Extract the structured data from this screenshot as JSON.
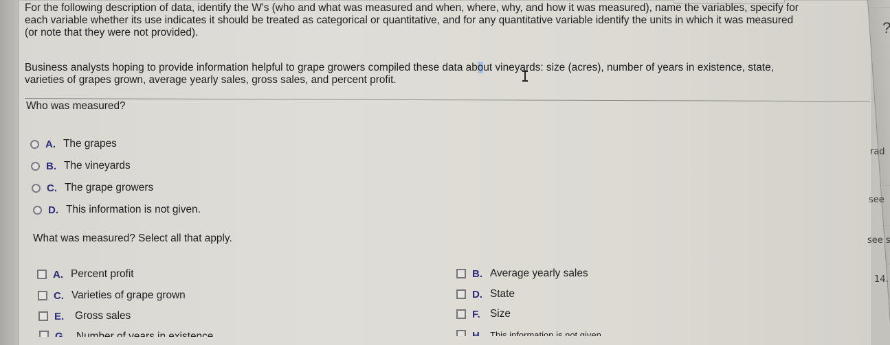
{
  "instructions": "For the following description of data, identify the W's (who and what was measured and when, where, why, and how it was measured), name the variables, specify for each variable whether its use indicates it should be treated as categorical or quantitative, and for any quantitative variable identify the units in which it was measured (or note that they were not provided).",
  "instructions_lines": [
    "For the following description of data, identify the W's (who and what was measured and when, where, why, and how it was measured), name the variables, specify for",
    "each variable whether its use indicates it should be treated as categorical or quantitative, and for any quantitative variable identify the units in which it was measured",
    "(or note that they were not provided)."
  ],
  "description": {
    "line1_before": "Business analysts hoping to provide information helpful to grape growers compiled these data ab",
    "line1_highlight": "o",
    "line1_after": "ut vineyards: size (acres), number of years in existence, state,",
    "line2": "varieties of grapes grown, average yearly sales, gross sales, and percent profit."
  },
  "question_who": {
    "prompt": "Who was measured?",
    "type": "radio",
    "options": [
      {
        "letter": "A.",
        "text": "The grapes",
        "selected": false
      },
      {
        "letter": "B.",
        "text": "The vineyards",
        "selected": false
      },
      {
        "letter": "C.",
        "text": "The grape growers",
        "selected": false
      },
      {
        "letter": "D.",
        "text": "This information is not given.",
        "selected": false
      }
    ]
  },
  "question_what": {
    "prompt": "What was measured? Select all that apply.",
    "type": "checkbox",
    "options": [
      {
        "letter": "A.",
        "text": "Percent profit",
        "checked": false
      },
      {
        "letter": "B.",
        "text": "Average yearly sales",
        "checked": false
      },
      {
        "letter": "C.",
        "text": "Varieties of grape grown",
        "checked": false
      },
      {
        "letter": "D.",
        "text": "State",
        "checked": false
      },
      {
        "letter": "E.",
        "text": "Gross sales",
        "checked": false
      },
      {
        "letter": "F.",
        "text": "Size",
        "checked": false
      },
      {
        "letter": "G.",
        "text": "Number of years in existence",
        "checked": false
      },
      {
        "letter": "H.",
        "text": "This information is not given.",
        "checked": false
      }
    ]
  },
  "side_panel": {
    "help_icon": "?",
    "fragments": [
      "rad",
      "see",
      "see s",
      "14."
    ]
  },
  "colors": {
    "option_letter": "#2c2c7a",
    "text": "#1d1d1d",
    "highlight": "#a9c0dd"
  }
}
